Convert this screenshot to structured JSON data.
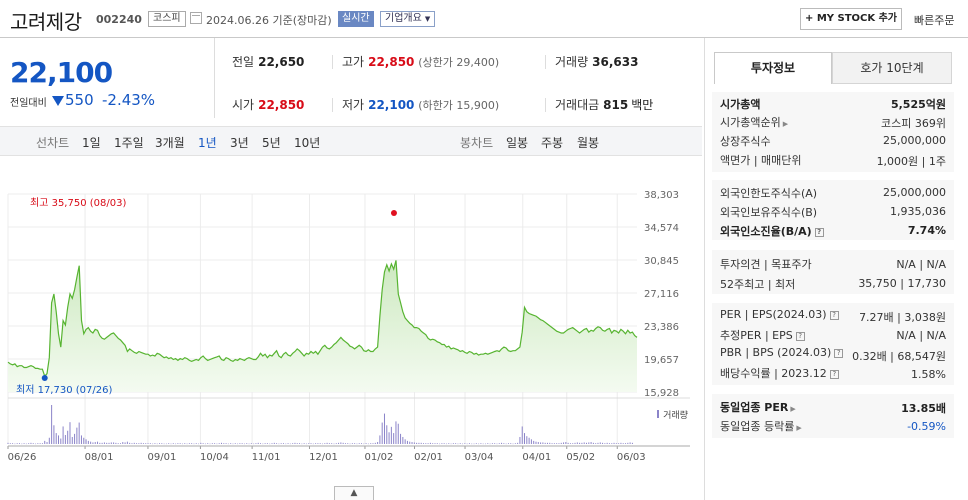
{
  "header": {
    "name": "고려제강",
    "code": "002240",
    "market": "코스피",
    "date_basis": "2024.06.26  기준(장마감)",
    "realtime": "실시간",
    "overview": "기업개요",
    "mystock": "+ MY STOCK 추가",
    "quick_order": "빠른주문"
  },
  "price": {
    "current": "22,100",
    "change_label": "전일대비",
    "change": "550",
    "change_pct": "-2.43%"
  },
  "quote": {
    "prev_label": "전일",
    "prev": "22,650",
    "high_label": "고가",
    "high": "22,850",
    "upper_limit": "(상한가 29,400)",
    "volume_label": "거래량",
    "volume": "36,633",
    "open_label": "시가",
    "open": "22,850",
    "low_label": "저가",
    "low": "22,100",
    "lower_limit": "(하한가 15,900)",
    "amount_label": "거래대금",
    "amount": "815",
    "amount_unit": "백만"
  },
  "periods": {
    "line_label": "선차트",
    "line": [
      "1일",
      "1주일",
      "3개월",
      "1년",
      "3년",
      "5년",
      "10년"
    ],
    "candle_label": "봉차트",
    "candle": [
      "일봉",
      "주봉",
      "월봉"
    ]
  },
  "chart_data": {
    "type": "area",
    "x_labels": [
      "06/26",
      "08/01",
      "09/01",
      "10/04",
      "11/01",
      "12/01",
      "01/02",
      "02/01",
      "03/04",
      "04/01",
      "05/02",
      "06/03"
    ],
    "y_ticks": [
      38303,
      34574,
      30845,
      27116,
      23386,
      19657,
      15928
    ],
    "ylim": [
      15928,
      38303
    ],
    "high_label": "최고 35,750 (08/03)",
    "low_label": "최저 17,730 (07/26)",
    "volume_legend": "거래량",
    "series": [
      {
        "values": [
          19300,
          19100,
          19000,
          19100,
          18800,
          18900,
          18900,
          18700,
          18700,
          18800,
          18900,
          18800,
          18600,
          18600,
          18500,
          18500,
          17730,
          18000,
          19800,
          26000,
          27000,
          25000,
          22500,
          21000,
          24000,
          23500,
          25500,
          27000,
          26500,
          27500,
          28900,
          30200,
          24000,
          22500,
          23000,
          23200,
          22800,
          22600,
          23000,
          22900,
          22300,
          22000,
          21900,
          22100,
          22300,
          22500,
          22600,
          22300,
          22000,
          21800,
          21500,
          21200,
          20500,
          20800,
          20600,
          20400,
          20300,
          20500,
          20400,
          20300,
          20200,
          20200,
          20000,
          20100,
          20000,
          20300,
          20200,
          20000,
          19800,
          19900,
          19700,
          19800,
          19600,
          19700,
          19500,
          19700,
          19600,
          19800,
          19700,
          19500,
          19400,
          19500,
          19600,
          19500,
          19800,
          20000,
          19700,
          19500,
          19600,
          19700,
          19800,
          19900,
          20000,
          19600,
          19500,
          19800,
          19700,
          19500,
          19400,
          19600,
          19500,
          19700,
          19600,
          19500,
          19700,
          19800,
          19700,
          19600,
          19600,
          19900,
          20300,
          20000,
          20200,
          19800,
          20100,
          20000,
          20300,
          20600,
          20000,
          19800,
          20200,
          20400,
          20100,
          20000,
          20300,
          20500,
          20800,
          20600,
          20300,
          20000,
          20300,
          20200,
          20500,
          20300,
          20500,
          20200,
          20600,
          21000,
          21200,
          20900,
          20800,
          21000,
          21300,
          21500,
          21800,
          22100,
          21800,
          21600,
          21400,
          21100,
          21000,
          20800,
          21000,
          21200,
          21000,
          20600,
          20500,
          20700,
          20500,
          20500,
          20800,
          21000,
          24500,
          27500,
          29500,
          30300,
          29600,
          30400,
          29800,
          30800,
          27000,
          26000,
          25000,
          24300,
          24000,
          23700,
          23500,
          23200,
          23200,
          23100,
          22800,
          22600,
          22400,
          22000,
          21800,
          21900,
          21800,
          21600,
          21500,
          21300,
          21300,
          21000,
          21100,
          20800,
          20900,
          20800,
          20700,
          20500,
          20600,
          20400,
          20300,
          20500,
          20400,
          20200,
          20300,
          20100,
          20200,
          20200,
          20300,
          20200,
          20300,
          20400,
          20500,
          20600,
          20500,
          20800,
          21000,
          20900,
          20600,
          20500,
          20600,
          20600,
          20800,
          21000,
          22700,
          25500,
          25000,
          24800,
          24700,
          24600,
          24500,
          24300,
          24100,
          24000,
          23800,
          23600,
          23400,
          23200,
          23000,
          22800,
          22700,
          22600,
          22600,
          22800,
          23000,
          23100,
          23200,
          23000,
          22800,
          22600,
          22800,
          23000,
          23100,
          22700,
          22900,
          22800,
          23100,
          23300,
          23200,
          22900,
          22800,
          23000,
          23100,
          22600,
          22900,
          22800,
          22600,
          23000,
          22800,
          22500,
          22900,
          22600,
          22700,
          22300,
          22100
        ]
      }
    ],
    "volume": [
      3,
      2,
      2,
      1,
      2,
      2,
      1,
      2,
      1,
      2,
      3,
      2,
      1,
      2,
      2,
      2,
      8,
      5,
      16,
      100,
      48,
      28,
      22,
      14,
      45,
      23,
      34,
      56,
      18,
      26,
      42,
      55,
      22,
      16,
      12,
      8,
      6,
      4,
      5,
      6,
      3,
      3,
      4,
      3,
      3,
      4,
      4,
      3,
      2,
      2,
      5,
      4,
      6,
      3,
      2,
      3,
      2,
      2,
      3,
      2,
      2,
      2,
      2,
      1,
      2,
      1,
      2,
      2,
      1,
      1,
      2,
      1,
      2,
      1,
      2,
      2,
      1,
      2,
      1,
      2,
      2,
      1,
      2,
      1,
      3,
      2,
      1,
      2,
      1,
      2,
      2,
      1,
      2,
      3,
      2,
      2,
      1,
      2,
      1,
      2,
      1,
      2,
      2,
      1,
      2,
      1,
      2,
      1,
      2,
      3,
      2,
      1,
      2,
      2,
      1,
      2,
      3,
      2,
      1,
      2,
      2,
      1,
      2,
      1,
      2,
      3,
      2,
      2,
      1,
      2,
      1,
      2,
      2,
      1,
      2,
      2,
      2,
      1,
      2,
      3,
      2,
      2,
      1,
      2,
      3,
      4,
      3,
      2,
      2,
      1,
      2,
      2,
      1,
      2,
      2,
      1,
      2,
      1,
      2,
      2,
      3,
      5,
      22,
      55,
      78,
      48,
      30,
      44,
      28,
      58,
      52,
      26,
      18,
      12,
      8,
      6,
      5,
      4,
      3,
      3,
      3,
      2,
      2,
      2,
      3,
      2,
      2,
      2,
      1,
      2,
      2,
      1,
      2,
      1,
      2,
      2,
      1,
      2,
      1,
      2,
      1,
      2,
      1,
      1,
      2,
      1,
      2,
      1,
      1,
      2,
      1,
      2,
      2,
      1,
      2,
      3,
      2,
      1,
      2,
      2,
      1,
      2,
      3,
      18,
      45,
      28,
      20,
      16,
      12,
      8,
      6,
      5,
      4,
      4,
      3,
      3,
      3,
      2,
      2,
      2,
      2,
      3,
      4,
      5,
      3,
      2,
      2,
      3,
      4,
      3,
      3,
      4,
      3,
      4,
      5,
      3,
      2,
      3,
      4,
      3,
      2,
      3,
      2,
      2,
      3,
      2,
      2,
      3,
      2,
      2,
      3,
      4,
      3
    ]
  },
  "right": {
    "tab_invest": "투자정보",
    "tab_hoga": "호가 10단계",
    "market_cap_label": "시가총액",
    "market_cap": "5,525억원",
    "cap_rank_label": "시가총액순위",
    "cap_rank": "코스피 369위",
    "listed_label": "상장주식수",
    "listed": "25,000,000",
    "par_label": "액면가 | 매매단위",
    "par": "1,000원 | 1주",
    "foreign_limit_label": "외국인한도주식수(A)",
    "foreign_limit": "25,000,000",
    "foreign_hold_label": "외국인보유주식수(B)",
    "foreign_hold": "1,935,036",
    "foreign_rate_label": "외국인소진율(B/A)",
    "foreign_rate": "7.74%",
    "opinion_label": "투자의견 | 목표주가",
    "opinion": "N/A | N/A",
    "week52_label": "52주최고 | 최저",
    "week52": "35,750 | 17,730",
    "per_label": "PER | EPS(2024.03)",
    "per": "7.27배 | 3,038원",
    "est_per_label": "추정PER | EPS",
    "est_per": "N/A | N/A",
    "pbr_label": "PBR | BPS (2024.03)",
    "pbr": "0.32배 | 68,547원",
    "div_label": "배당수익률 | 2023.12",
    "div": "1.58%",
    "ind_per_label": "동일업종 PER",
    "ind_per": "13.85배",
    "ind_chg_label": "동일업종 등락률",
    "ind_chg": "-0.59%"
  }
}
